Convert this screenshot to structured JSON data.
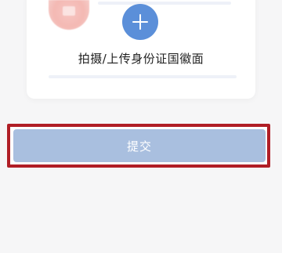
{
  "upload": {
    "label": "拍摄/上传身份证国徽面",
    "add_icon": "plus-icon",
    "emblem_icon": "national-emblem-icon"
  },
  "submit": {
    "label": "提交",
    "state": "disabled",
    "highlight_color": "#b01e26"
  },
  "colors": {
    "accent": "#5b8fd9",
    "submit_disabled": "#a9bfdf",
    "background": "#f6f6f7"
  }
}
